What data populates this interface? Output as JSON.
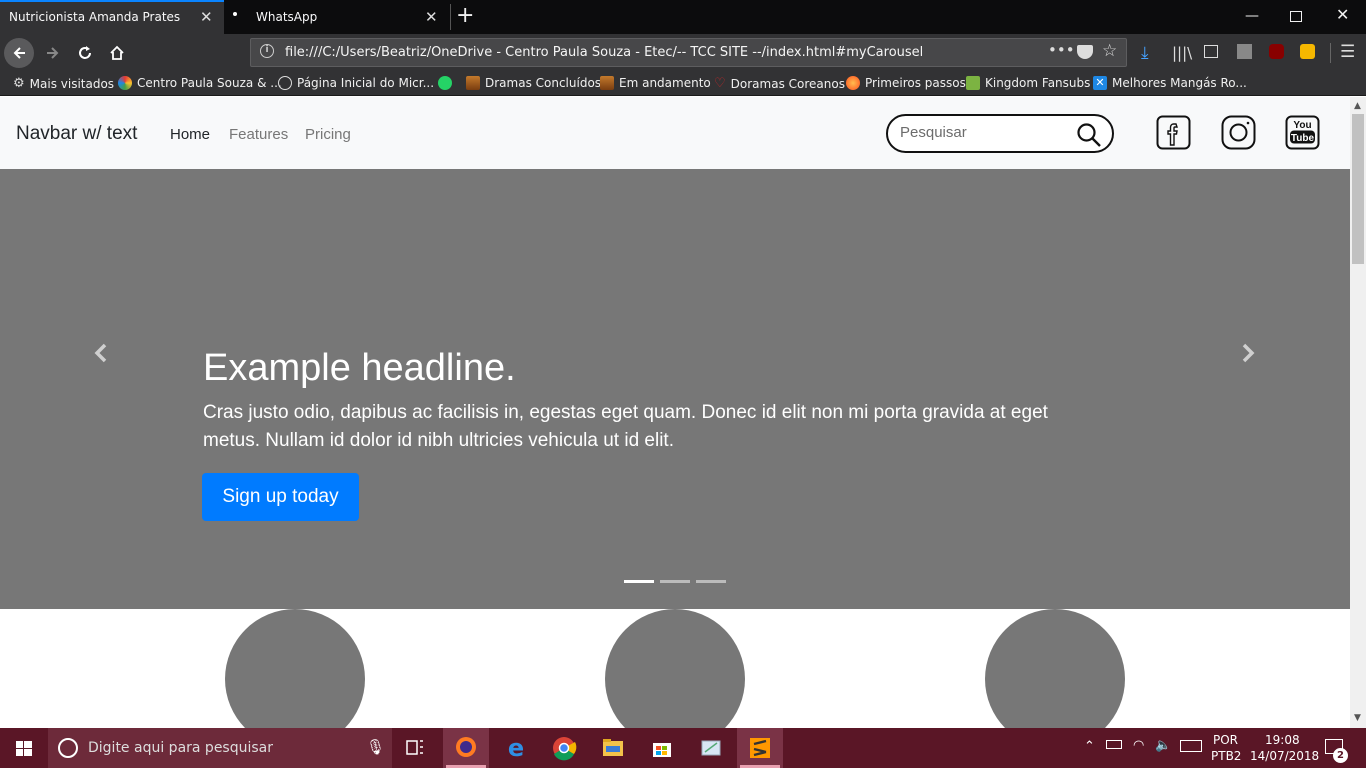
{
  "browser": {
    "tabs": [
      {
        "title": "Nutricionista Amanda Prates",
        "active": true
      },
      {
        "title": "WhatsApp",
        "active": false
      }
    ],
    "url": "file:///C:/Users/Beatriz/OneDrive - Centro Paula Souza - Etec/-- TCC SITE --/index.html#myCarousel",
    "bookmarks": [
      {
        "label": "Mais visitados",
        "icon": "gear-icon"
      },
      {
        "label": "Centro Paula Souza & ...",
        "icon": "colorful-icon"
      },
      {
        "label": "Página Inicial do Micr...",
        "icon": "globe-icon"
      },
      {
        "label": "",
        "icon": "whatsapp-icon"
      },
      {
        "label": "Dramas Concluídos",
        "icon": "folder-icon"
      },
      {
        "label": "Em andamento",
        "icon": "folder-icon"
      },
      {
        "label": "Doramas Coreanos",
        "icon": "heart-icon"
      },
      {
        "label": "Primeiros passos",
        "icon": "firefox-icon"
      },
      {
        "label": "Kingdom Fansubs",
        "icon": "chat-icon"
      },
      {
        "label": "Melhores Mangás Ro...",
        "icon": "x-icon"
      }
    ]
  },
  "site": {
    "brand": "Navbar w/ text",
    "nav": [
      "Home",
      "Features",
      "Pricing"
    ],
    "search_placeholder": "Pesquisar",
    "social": [
      "facebook-icon",
      "instagram-icon",
      "youtube-icon"
    ],
    "youtube_text": [
      "You",
      "Tube"
    ]
  },
  "carousel": {
    "headline": "Example headline.",
    "lead": "Cras justo odio, dapibus ac facilisis in, egestas eget quam. Donec id elit non mi porta gravida at eget metus. Nullam id dolor id nibh ultricies vehicula ut id elit.",
    "button": "Sign up today",
    "indicators": 3,
    "active_indicator": 0
  },
  "taskbar": {
    "search_placeholder": "Digite aqui para pesquisar",
    "lang": "POR",
    "layout": "PTB2",
    "time": "19:08",
    "date": "14/07/2018",
    "notifications": "2"
  },
  "colors": {
    "accent": "#0a84ff",
    "primary_button": "#007bff",
    "carousel_bg": "#777777",
    "taskbar_bg": "#5a1626"
  }
}
